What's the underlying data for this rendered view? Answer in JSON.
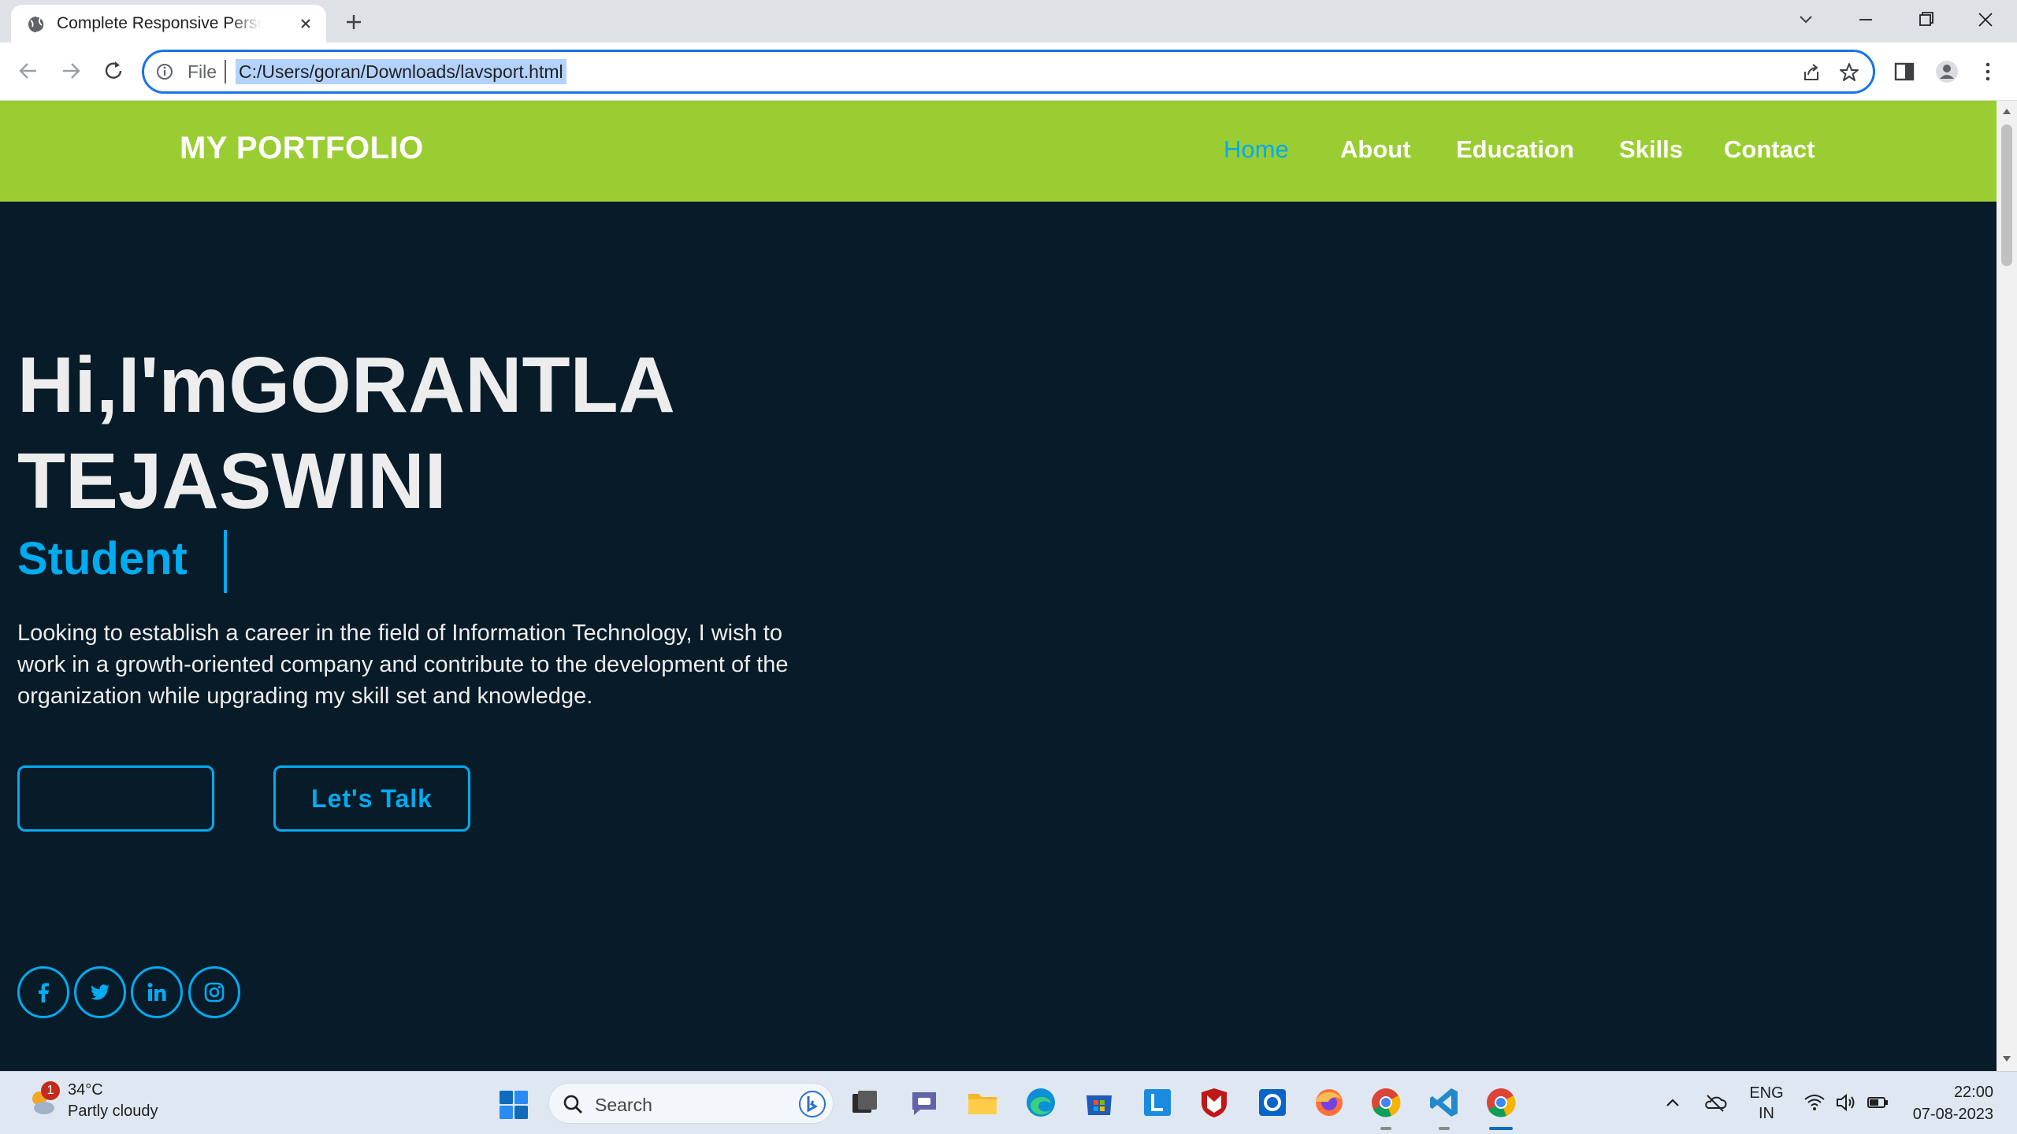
{
  "browser": {
    "tab_title": "Complete Responsive Personal Portfolio Website",
    "omnibox_scheme": "File",
    "url": "C:/Users/goran/Downloads/lavsport.html",
    "accent_color": "#1a73e8"
  },
  "site": {
    "logo": "MY PORTFOLIO",
    "nav": [
      "Home",
      "About",
      "Education",
      "Skills",
      "Contact"
    ],
    "active_nav": "Home",
    "hero": {
      "title_line1": "Hi,I'mGORANTLA",
      "title_line2": "TEJASWINI",
      "role": "Student",
      "description": "Looking to establish a career in the field of Information Technology, I wish to work in a growth-oriented company and contribute to the development of the organization while upgrading my skill set and knowledge.",
      "primary_button": "",
      "secondary_button": "Let's Talk"
    },
    "social": [
      "facebook-icon",
      "twitter-icon",
      "linkedin-icon",
      "instagram-icon"
    ],
    "colors": {
      "header_bg": "#9acd32",
      "page_bg": "#081b29",
      "accent": "#00abf0",
      "text": "#ededed"
    }
  },
  "taskbar": {
    "weather_temp": "34°C",
    "weather_desc": "Partly cloudy",
    "weather_badge": "1",
    "search_placeholder": "Search",
    "language_line1": "ENG",
    "language_line2": "IN",
    "time": "22:00",
    "date": "07-08-2023"
  }
}
